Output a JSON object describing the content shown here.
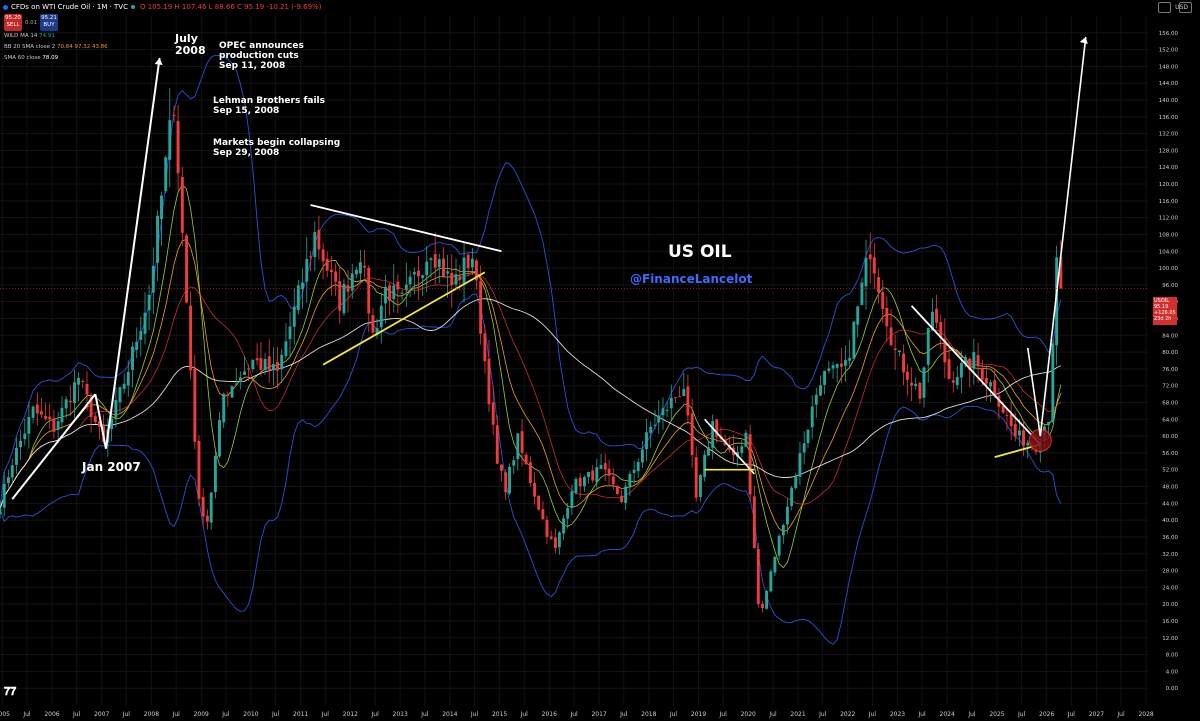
{
  "header": {
    "symbol": "CFDs on WTI Crude Oil · 1M · TVC",
    "ohlc": "O 105.19  H 107.46  L 88.66  C 95.19  -10.21 (-9.69%)",
    "sell_price": "95.20",
    "sell_label": "SELL",
    "spread": "0.01",
    "buy_price": "95.21",
    "buy_label": "BUY"
  },
  "indicators": [
    {
      "label": "WILD MA 14",
      "value": "74.91",
      "color": "#26a69a"
    },
    {
      "label": "BB 20 SMA close 2",
      "value": "70.84  97.32  43.86",
      "color": "#f7931a"
    },
    {
      "label": "SMA 60 close",
      "value": "78.09",
      "color": "#ffffff"
    }
  ],
  "price_label": {
    "symbol": "USOIL",
    "price": "95.19",
    "change": "+126.05",
    "countdown": "23d 2h"
  },
  "currency": "USD",
  "overlay": {
    "title": "US OIL",
    "handle": "@FinanceLancelot",
    "july_line1": "July",
    "july_line2": "2008",
    "jan2007": "Jan 2007",
    "opec_line1": "OPEC announces",
    "opec_line2": "production cuts",
    "opec_line3": "Sep 11, 2008",
    "lehman_line1": "Lehman Brothers fails",
    "lehman_line2": "Sep 15, 2008",
    "markets_line1": "Markets begin collapsing",
    "markets_line2": "Sep 29, 2008"
  },
  "colors": {
    "up": "#26a69a",
    "down": "#ef3b3b",
    "bb": "#2f4fd6",
    "ema": "#9acd32",
    "wma": "#e8a317",
    "sma": "#ffffff"
  },
  "chart_data": {
    "type": "candlestick",
    "interval": "1M",
    "x_label": "date",
    "y_label": "USD",
    "ylim": [
      -4,
      160
    ],
    "y_ticks": [
      0,
      4,
      8,
      12,
      16,
      20,
      24,
      28,
      32,
      36,
      40,
      44,
      48,
      52,
      56,
      60,
      64,
      68,
      72,
      76,
      80,
      84,
      88,
      92,
      96,
      100,
      104,
      108,
      112,
      116,
      120,
      124,
      128,
      132,
      136,
      140,
      144,
      148,
      152,
      156
    ],
    "x_ticks": [
      "2005",
      "Jul",
      "2006",
      "Jul",
      "2007",
      "Jul",
      "2008",
      "Jul",
      "2009",
      "Jul",
      "2010",
      "Jul",
      "2011",
      "Jul",
      "2012",
      "Jul",
      "2013",
      "Jul",
      "2014",
      "Jul",
      "2015",
      "Jul",
      "2016",
      "Jul",
      "2017",
      "Jul",
      "2018",
      "Jul",
      "2019",
      "Jul",
      "2020",
      "Jul",
      "2021",
      "Jul",
      "2022",
      "Jul",
      "2023",
      "Jul",
      "2024",
      "Jul",
      "2025",
      "Jul",
      "2026",
      "Jul",
      "2027",
      "Jul",
      "2028"
    ],
    "x_range": [
      "2004-12-15",
      "2028-01-15"
    ],
    "anchors": [
      [
        "2004-12-15",
        44
      ],
      [
        "2005-03-15",
        54
      ],
      [
        "2005-08-15",
        66
      ],
      [
        "2006-01-15",
        62
      ],
      [
        "2006-07-15",
        74
      ],
      [
        "2007-01-15",
        58
      ],
      [
        "2007-07-15",
        76
      ],
      [
        "2007-12-15",
        94
      ],
      [
        "2008-06-15",
        140
      ],
      [
        "2008-12-15",
        44
      ],
      [
        "2009-02-15",
        40
      ],
      [
        "2009-06-15",
        70
      ],
      [
        "2010-01-15",
        78
      ],
      [
        "2010-07-15",
        75
      ],
      [
        "2011-04-15",
        108
      ],
      [
        "2011-10-15",
        92
      ],
      [
        "2012-03-15",
        104
      ],
      [
        "2012-06-15",
        84
      ],
      [
        "2012-09-15",
        95
      ],
      [
        "2013-01-15",
        92
      ],
      [
        "2013-08-15",
        105
      ],
      [
        "2014-01-15",
        96
      ],
      [
        "2014-06-15",
        103
      ],
      [
        "2014-12-15",
        53
      ],
      [
        "2015-02-15",
        48
      ],
      [
        "2015-05-15",
        59
      ],
      [
        "2015-12-15",
        37
      ],
      [
        "2016-02-15",
        33
      ],
      [
        "2016-06-15",
        48
      ],
      [
        "2017-01-15",
        52
      ],
      [
        "2017-06-15",
        45
      ],
      [
        "2018-01-15",
        62
      ],
      [
        "2018-09-15",
        72
      ],
      [
        "2018-12-15",
        45
      ],
      [
        "2019-04-15",
        63
      ],
      [
        "2019-09-15",
        54
      ],
      [
        "2019-12-15",
        61
      ],
      [
        "2020-03-15",
        20
      ],
      [
        "2020-04-15",
        19
      ],
      [
        "2020-09-15",
        40
      ],
      [
        "2021-06-15",
        74
      ],
      [
        "2021-12-15",
        76
      ],
      [
        "2022-06-15",
        105
      ],
      [
        "2022-12-15",
        80
      ],
      [
        "2023-06-15",
        70
      ],
      [
        "2023-09-15",
        90
      ],
      [
        "2024-01-15",
        74
      ],
      [
        "2024-07-15",
        78
      ],
      [
        "2024-12-15",
        71
      ],
      [
        "2025-05-15",
        60
      ],
      [
        "2025-10-15",
        58
      ],
      [
        "2026-01-15",
        65
      ],
      [
        "2026-03-15",
        100
      ],
      [
        "2026-04-15",
        95
      ]
    ],
    "series": [
      {
        "name": "WILD MA 14"
      },
      {
        "name": "BB 20 SMA close 2"
      },
      {
        "name": "SMA 60 close"
      }
    ]
  }
}
